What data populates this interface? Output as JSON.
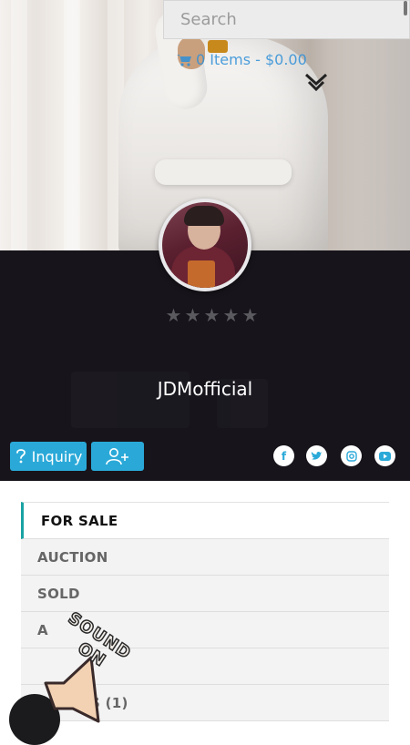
{
  "search": {
    "placeholder": "Search"
  },
  "cart": {
    "label": "0 Items - $0.00",
    "icon": "shopping-cart-icon"
  },
  "profile": {
    "username": "JDMofficial",
    "rating": {
      "value": 0,
      "max": 5
    },
    "actions": {
      "inquiry_label": "Inquiry",
      "follow_icon": "user-plus-icon"
    },
    "social": [
      "facebook-icon",
      "twitter-icon",
      "instagram-icon",
      "youtube-icon"
    ]
  },
  "tabs": [
    {
      "label": "FOR SALE",
      "active": true
    },
    {
      "label": "AUCTION",
      "active": false
    },
    {
      "label": "SOLD",
      "active": false
    },
    {
      "label": "A",
      "active": false
    },
    {
      "label": "",
      "active": false
    },
    {
      "label": "S (1)",
      "active": false
    }
  ],
  "overlay": {
    "line1": "SOUND",
    "line2": "ON"
  },
  "colors": {
    "accent": "#2aa9d8",
    "header_bg": "#17141b",
    "active_tab_border": "#1aa3a3"
  }
}
